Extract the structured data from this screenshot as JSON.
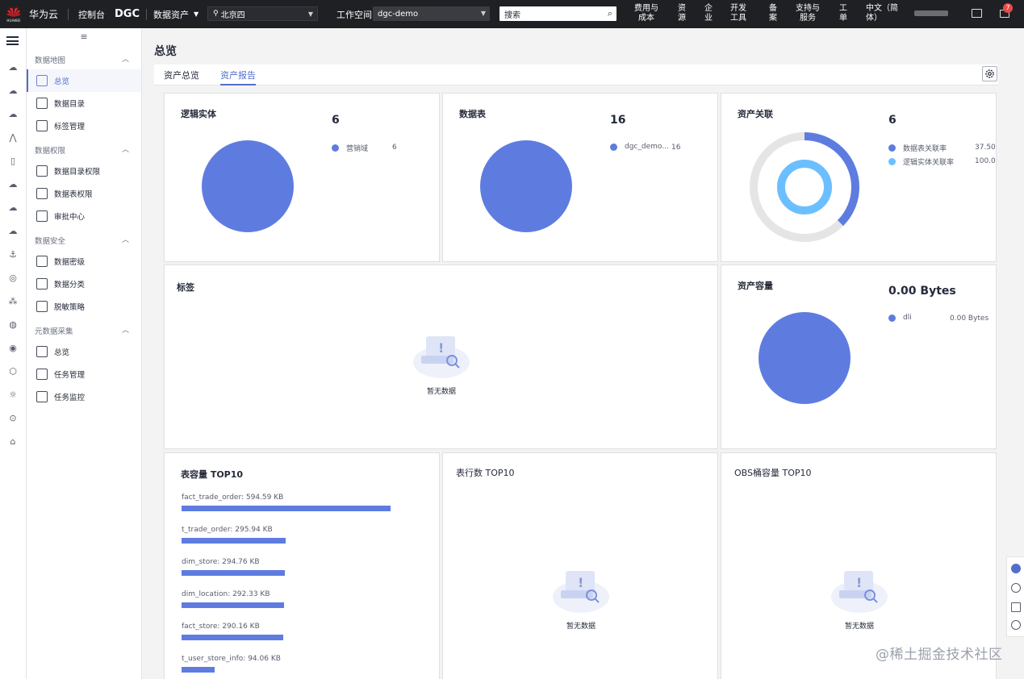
{
  "topbar": {
    "brand": "华为云",
    "logo_sub": "HUAWEI",
    "console": "控制台",
    "product": "DGC",
    "module": "数据资产",
    "region": "北京四",
    "workspace_label": "工作空间",
    "workspace": "dgc-demo",
    "search_placeholder": "搜索",
    "billing_1": "费用与",
    "billing_2": "成本",
    "resource_1": "资",
    "resource_2": "源",
    "enterprise_1": "企",
    "enterprise_2": "业",
    "devtools_1": "开发",
    "devtools_2": "工具",
    "filing_1": "备",
    "filing_2": "案",
    "support_1": "支持与",
    "support_2": "服务",
    "ticket_1": "工",
    "ticket_2": "单",
    "lang_1": "中文（简",
    "lang_2": "体）",
    "notif_count": "7"
  },
  "sidebar": {
    "groups": [
      {
        "label": "数据地图",
        "items": [
          {
            "label": "总览",
            "icon": "layers-icon",
            "active": true
          },
          {
            "label": "数据目录",
            "icon": "catalog-icon"
          },
          {
            "label": "标签管理",
            "icon": "tag-icon"
          }
        ]
      },
      {
        "label": "数据权限",
        "items": [
          {
            "label": "数据目录权限",
            "icon": "doc-lock-icon"
          },
          {
            "label": "数据表权限",
            "icon": "table-lock-icon"
          },
          {
            "label": "审批中心",
            "icon": "approve-icon"
          }
        ]
      },
      {
        "label": "数据安全",
        "items": [
          {
            "label": "数据密级",
            "icon": "shield-icon"
          },
          {
            "label": "数据分类",
            "icon": "grid-icon"
          },
          {
            "label": "脱敏策略",
            "icon": "mask-icon"
          }
        ]
      },
      {
        "label": "元数据采集",
        "items": [
          {
            "label": "总览",
            "icon": "layers-icon"
          },
          {
            "label": "任务管理",
            "icon": "task-icon"
          },
          {
            "label": "任务监控",
            "icon": "monitor-icon"
          }
        ]
      }
    ]
  },
  "main": {
    "title": "总览",
    "tabs": [
      "资产总览",
      "资产报告"
    ],
    "active_tab": 1
  },
  "cards": {
    "logic": {
      "title": "逻辑实体",
      "total": "6",
      "legend": [
        {
          "name": "营销域",
          "value": "6"
        }
      ]
    },
    "tables": {
      "title": "数据表",
      "total": "16",
      "legend": [
        {
          "name": "dgc_demo...",
          "value": "16"
        }
      ]
    },
    "relation": {
      "title": "资产关联",
      "total": "6",
      "legend": [
        {
          "name": "数据表关联率",
          "value": "37.50%"
        },
        {
          "name": "逻辑实体关联率",
          "value": "100.00"
        }
      ],
      "outer_ratio": 0.375,
      "inner_ratio": 1.0
    },
    "tags": {
      "title": "标签",
      "empty": "暂无数据"
    },
    "capacity": {
      "title": "资产容量",
      "total": "0.00  Bytes",
      "legend": [
        {
          "name": "dli",
          "value": "0.00  Bytes"
        }
      ]
    },
    "top_size": {
      "title": "表容量 TOP10",
      "rows": [
        {
          "label": "fact_trade_order: 594.59  KB",
          "value": 594.59
        },
        {
          "label": "t_trade_order: 295.94  KB",
          "value": 295.94
        },
        {
          "label": "dim_store: 294.76  KB",
          "value": 294.76
        },
        {
          "label": "dim_location: 292.33  KB",
          "value": 292.33
        },
        {
          "label": "fact_store: 290.16  KB",
          "value": 290.16
        },
        {
          "label": "t_user_store_info: 94.06  KB",
          "value": 94.06
        }
      ]
    },
    "top_rows": {
      "title": "表行数 TOP10",
      "empty": "暂无数据"
    },
    "top_obs": {
      "title": "OBS桶容量 TOP10",
      "empty": "暂无数据"
    }
  },
  "colors": {
    "primary": "#5e7ce0",
    "light": "#6cbfff",
    "track": "#e5e5e5",
    "accent": "#526ecc"
  },
  "watermark": "@稀土掘金技术社区"
}
